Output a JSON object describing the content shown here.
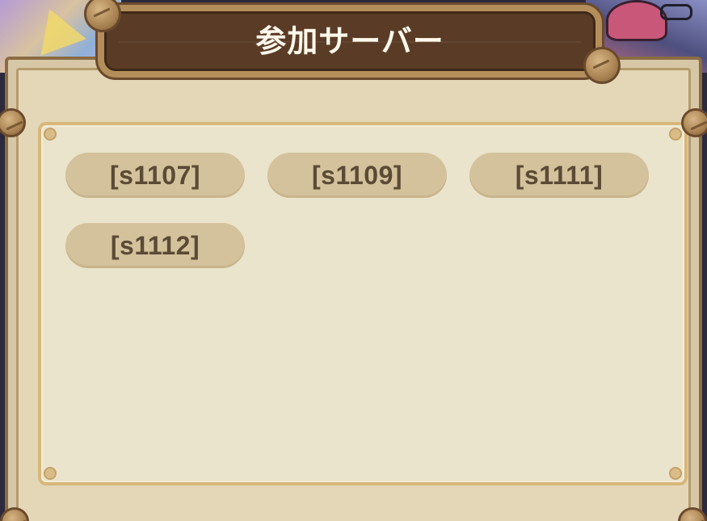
{
  "dialog": {
    "title": "参加サーバー"
  },
  "servers": [
    {
      "label": "[s1107]"
    },
    {
      "label": "[s1109]"
    },
    {
      "label": "[s1111]"
    },
    {
      "label": "[s1112]"
    }
  ],
  "colors": {
    "title_plaque": "#5a3c26",
    "panel_frame": "#8a6c45",
    "content_bg": "#ebe4cc",
    "server_button_bg": "#d3c29b",
    "server_button_text": "#5b4a35"
  }
}
